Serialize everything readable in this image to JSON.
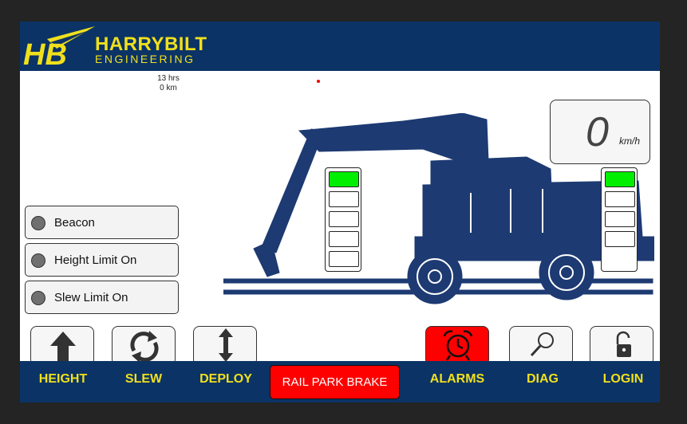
{
  "brand": {
    "line1": "HARRYBILT",
    "line2": "ENGINEERING",
    "logo_text": "HB"
  },
  "stats": {
    "hours": "13 hrs",
    "distance": "0 km"
  },
  "indicators": [
    {
      "label": "Beacon",
      "state": "off"
    },
    {
      "label": "Height Limit On",
      "state": "off"
    },
    {
      "label": "Slew Limit On",
      "state": "off"
    }
  ],
  "left_stack": {
    "lit_cells": 1,
    "total_cells": 5
  },
  "right_stack": {
    "lit_cells": 1,
    "total_cells": 4
  },
  "speed": {
    "value": "0",
    "unit": "km/h"
  },
  "buttons": [
    {
      "label": "HEIGHT",
      "icon": "up-arrow-icon"
    },
    {
      "label": "SLEW",
      "icon": "rotate-icon"
    },
    {
      "label": "DEPLOY",
      "icon": "vertical-arrows-icon"
    },
    {
      "label": "RAIL PARK BRAKE",
      "active": true
    },
    {
      "label": "ALARMS",
      "icon": "alarm-clock-icon",
      "active": true
    },
    {
      "label": "DIAG",
      "icon": "magnifier-icon"
    },
    {
      "label": "LOGIN",
      "icon": "padlock-icon"
    }
  ],
  "colors": {
    "brand_navy": "#0b3366",
    "brand_yellow": "#f0e01c",
    "alarm_red": "#ff0000",
    "status_green": "#00ee00",
    "machine_blue": "#1d3a72"
  }
}
